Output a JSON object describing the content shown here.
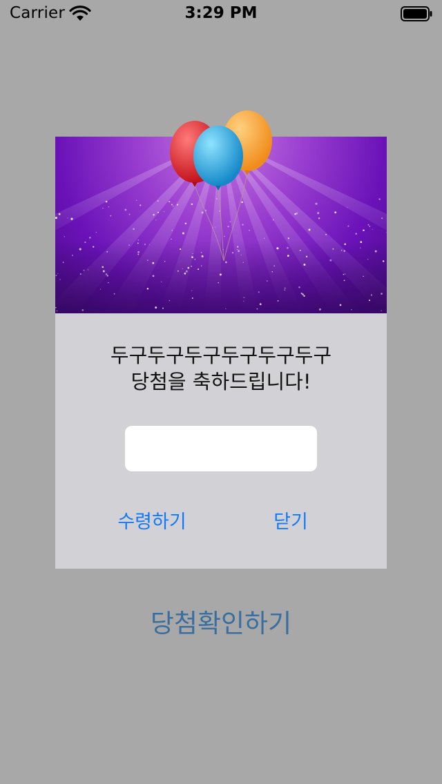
{
  "status_bar": {
    "carrier": "Carrier",
    "time": "3:29 PM",
    "icons": [
      "wifi-icon",
      "battery-icon"
    ]
  },
  "popup": {
    "message_line1": "두구두구두구두구두구두구",
    "message_line2": "당첨을 축하드립니다!",
    "input": {
      "value": "",
      "placeholder": ""
    },
    "receive_label": "수령하기",
    "close_label": "닫기",
    "banner_graphic": "balloons-on-purple-light-rays"
  },
  "main": {
    "check_button_label": "당첨확인하기"
  },
  "colors": {
    "background": "#a8a8a8",
    "popup_bg": "#d2d2d6",
    "action_blue": "#1479f5",
    "check_button": "#3a6e9f"
  }
}
